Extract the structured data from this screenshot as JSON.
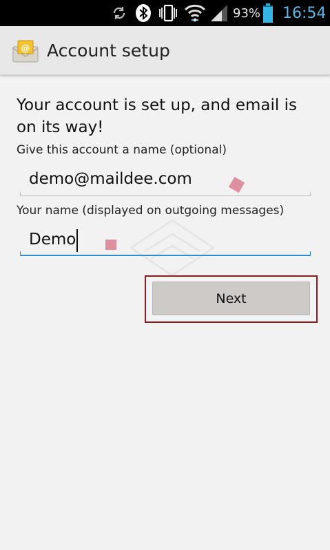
{
  "status_bar": {
    "battery_percent": "93%",
    "time": "16:54",
    "icons": [
      "sync-icon",
      "bluetooth-icon",
      "vibrate-icon",
      "wifi-icon",
      "signal-icon",
      "battery-icon"
    ]
  },
  "action_bar": {
    "title": "Account setup",
    "icon": "email-app-icon"
  },
  "main": {
    "headline": "Your account is set up, and email is on its way!",
    "account_name": {
      "label": "Give this account a name (optional)",
      "value": "demo@maildee.com"
    },
    "your_name": {
      "label": "Your name (displayed on outgoing messages)",
      "value": "Demo"
    },
    "next_button": "Next"
  },
  "colors": {
    "accent_focus": "#2c8cd6",
    "highlight_border": "#8b1a1f",
    "marker": "#dd8fa0",
    "battery": "#33b5e5"
  }
}
